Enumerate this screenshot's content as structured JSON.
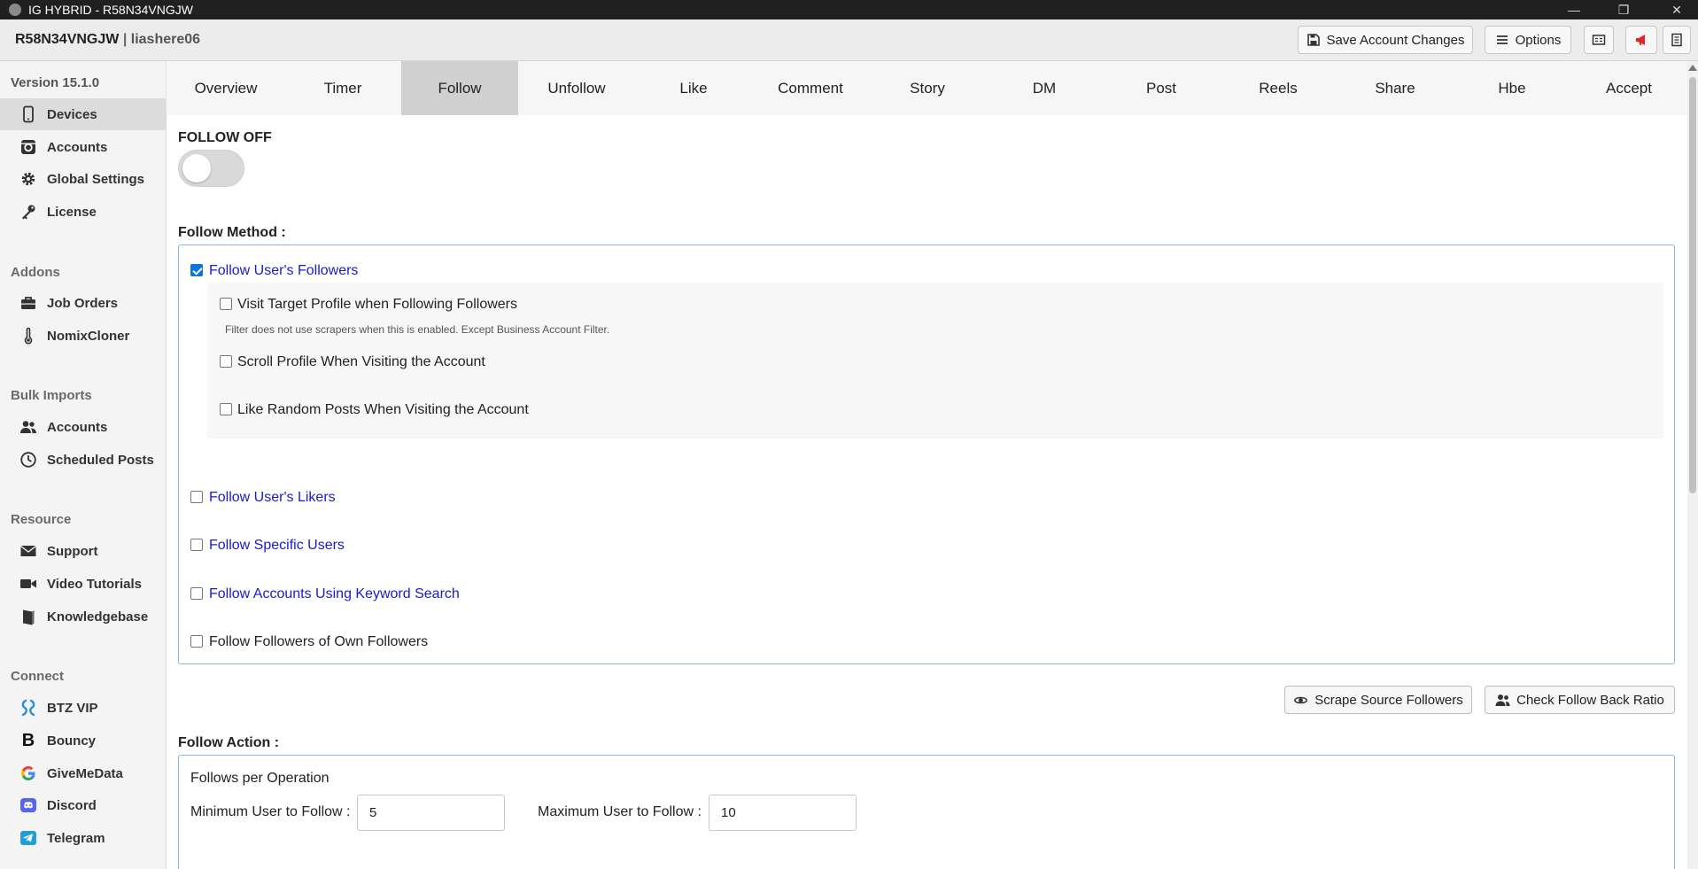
{
  "window": {
    "title": "IG HYBRID - R58N34VNGJW"
  },
  "header": {
    "device_id": "R58N34VNGJW",
    "separator": "|",
    "username": "liashere06",
    "save_label": "Save Account Changes",
    "options_label": "Options"
  },
  "sidebar": {
    "version": "Version 15.1.0",
    "main_items": [
      {
        "label": "Devices",
        "icon": "phone-icon"
      },
      {
        "label": "Accounts",
        "icon": "instagram-icon"
      },
      {
        "label": "Global Settings",
        "icon": "gear-icon"
      },
      {
        "label": "License",
        "icon": "key-icon"
      }
    ],
    "addons_heading": "Addons",
    "addons": [
      {
        "label": "Job Orders",
        "icon": "briefcase-icon"
      },
      {
        "label": "NomixCloner",
        "icon": "thermometer-icon"
      }
    ],
    "bulk_heading": "Bulk Imports",
    "bulk": [
      {
        "label": "Accounts",
        "icon": "users-icon"
      },
      {
        "label": "Scheduled Posts",
        "icon": "clock-icon"
      }
    ],
    "resource_heading": "Resource",
    "resource": [
      {
        "label": "Support",
        "icon": "envelope-icon"
      },
      {
        "label": "Video Tutorials",
        "icon": "video-icon"
      },
      {
        "label": "Knowledgebase",
        "icon": "book-icon"
      }
    ],
    "connect_heading": "Connect",
    "connect": [
      {
        "label": "BTZ VIP",
        "icon": "btz-icon"
      },
      {
        "label": "Bouncy",
        "icon": "bouncy-icon"
      },
      {
        "label": "GiveMeData",
        "icon": "google-icon"
      },
      {
        "label": "Discord",
        "icon": "discord-icon"
      },
      {
        "label": "Telegram",
        "icon": "telegram-icon"
      }
    ]
  },
  "tabs": [
    "Overview",
    "Timer",
    "Follow",
    "Unfollow",
    "Like",
    "Comment",
    "Story",
    "DM",
    "Post",
    "Reels",
    "Share",
    "Hbe",
    "Accept"
  ],
  "active_tab": "Follow",
  "follow": {
    "status_label": "FOLLOW OFF",
    "enabled": false,
    "method_heading": "Follow Method :",
    "methods": {
      "followers": {
        "label": "Follow User's Followers",
        "checked": true
      },
      "visit_target": {
        "label": "Visit Target Profile when Following Followers",
        "checked": false
      },
      "visit_note": "Filter does not use scrapers when this is enabled. Except Business Account Filter.",
      "scroll_profile": {
        "label": "Scroll Profile When Visiting the Account",
        "checked": false
      },
      "like_random": {
        "label": "Like Random Posts When Visiting the Account",
        "checked": false
      },
      "likers": {
        "label": "Follow User's Likers",
        "checked": false
      },
      "specific": {
        "label": "Follow Specific Users",
        "checked": false
      },
      "keyword": {
        "label": "Follow Accounts Using Keyword Search",
        "checked": false
      },
      "own_followers": {
        "label": "Follow Followers of Own Followers",
        "checked": false
      }
    },
    "scrape_button": "Scrape Source Followers",
    "check_ratio_button": "Check Follow Back Ratio",
    "action_heading": "Follow Action :",
    "per_operation_label": "Follows per Operation",
    "min_label": "Minimum User to Follow :",
    "min_value": "5",
    "max_label": "Maximum User to Follow :",
    "max_value": "10"
  },
  "colors": {
    "link": "#1a1ad0",
    "accent_blue": "#0b74de",
    "announce_red": "#e0262c",
    "panel_border": "#8cb4e0"
  }
}
